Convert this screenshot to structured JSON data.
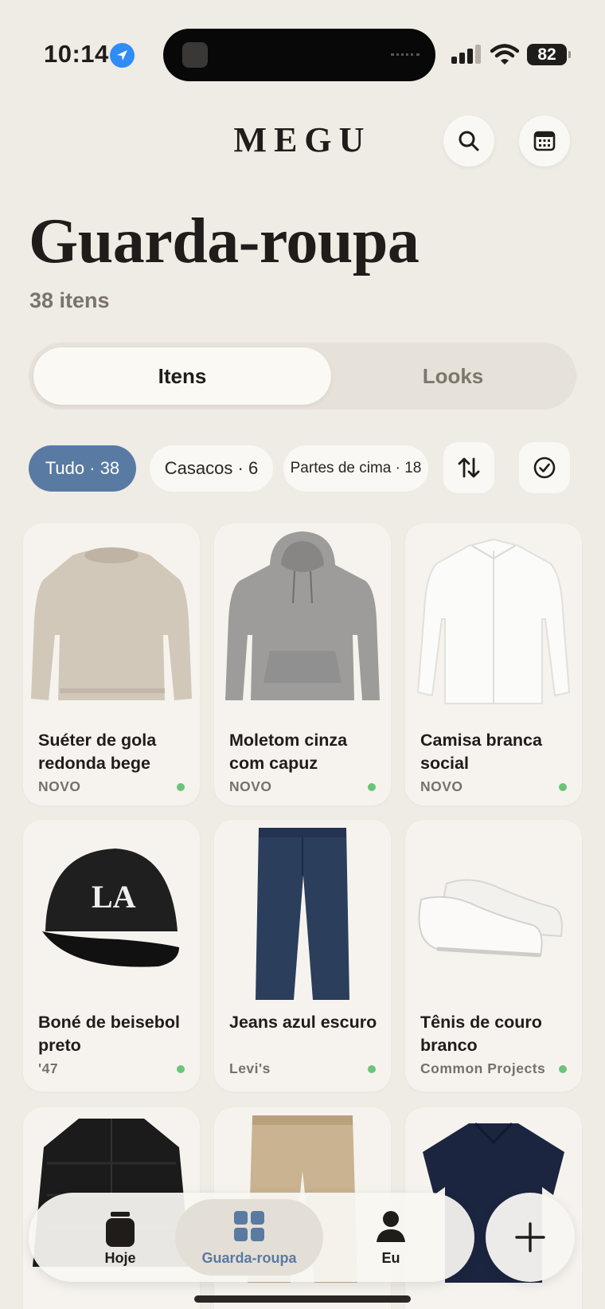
{
  "status": {
    "time": "10:14",
    "battery": "82"
  },
  "header": {
    "brand": "MEGU",
    "search_icon": "search-icon",
    "calendar_icon": "calendar-icon"
  },
  "page": {
    "title": "Guarda-roupa",
    "count": "38 itens"
  },
  "segments": {
    "items": "Itens",
    "looks": "Looks",
    "selected": "Itens"
  },
  "filters": {
    "chips": [
      {
        "label": "Tudo · 38",
        "active": true
      },
      {
        "label": "Casacos · 6",
        "active": false
      },
      {
        "label": "Partes de cima · 18",
        "active": false
      }
    ],
    "sort_icon": "sort-icon",
    "select_icon": "check-circle-icon"
  },
  "items": [
    {
      "name": "Suéter de gola redonda bege",
      "meta": "NOVO",
      "status_color": "#6cc477"
    },
    {
      "name": "Moletom cinza com capuz",
      "meta": "NOVO",
      "status_color": "#6cc477"
    },
    {
      "name": "Camisa branca social",
      "meta": "NOVO",
      "status_color": "#6cc477"
    },
    {
      "name": "Boné de beisebol preto",
      "meta": "'47",
      "status_color": "#6cc477"
    },
    {
      "name": "Jeans azul escuro",
      "meta": "Levi's",
      "status_color": "#6cc477"
    },
    {
      "name": "Tênis de couro branco",
      "meta": "Common Projects",
      "status_color": "#6cc477"
    },
    {
      "name": "",
      "meta": ""
    },
    {
      "name": "",
      "meta": ""
    },
    {
      "name": "",
      "meta": ""
    }
  ],
  "tabbar": {
    "today": "Hoje",
    "wardrobe": "Guarda-roupa",
    "me": "Eu",
    "active": "Guarda-roupa",
    "accent": "#5a7aa2"
  },
  "colors": {
    "background": "#efebe5",
    "chip_active": "#587aa3",
    "status_dot": "#6cc477"
  }
}
